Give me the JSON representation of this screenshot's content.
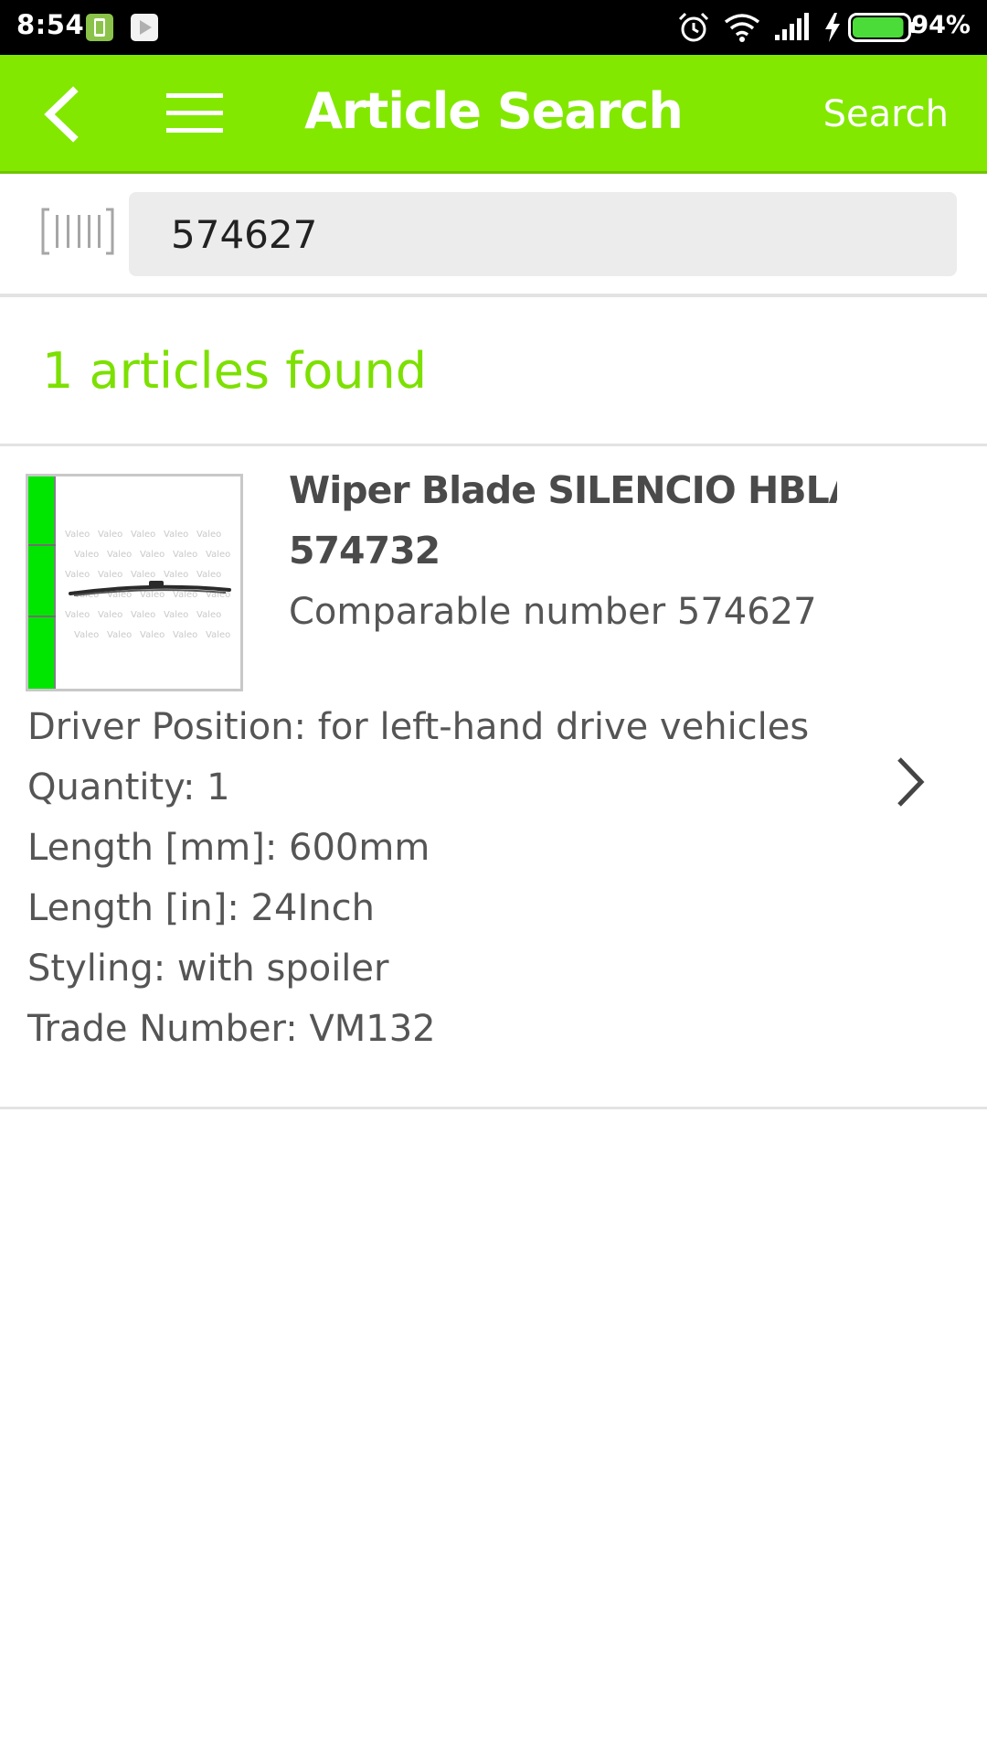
{
  "status_bar": {
    "time": "8:54",
    "battery_percent": "94%",
    "battery_level": 0.94,
    "icons": [
      "sim-card-icon",
      "play-store-icon",
      "alarm-icon",
      "wifi-icon",
      "signal-icon",
      "charging-icon",
      "battery-icon"
    ]
  },
  "app_bar": {
    "title": "Article Search",
    "search_label": "Search",
    "color": "#82e800",
    "back_icon": "back-arrow-icon",
    "menu_icon": "hamburger-menu-icon"
  },
  "search": {
    "query": "574627",
    "barcode_icon": "barcode-icon"
  },
  "results": {
    "count_text": "1 articles found",
    "count_color": "#7ce000",
    "articles": [
      {
        "title": "Wiper Blade SILENCIO HBLA...",
        "number": "574732",
        "comparable": "Comparable number 574627",
        "attributes": [
          "Driver Position: for left-hand drive vehicles",
          "Quantity: 1",
          "Length [mm]: 600mm",
          "Length [in]: 24Inch",
          "Styling: with spoiler",
          "Trade Number: VM132"
        ],
        "thumbnail_watermark": "Valeo",
        "chevron_icon": "chevron-right-icon"
      }
    ]
  }
}
